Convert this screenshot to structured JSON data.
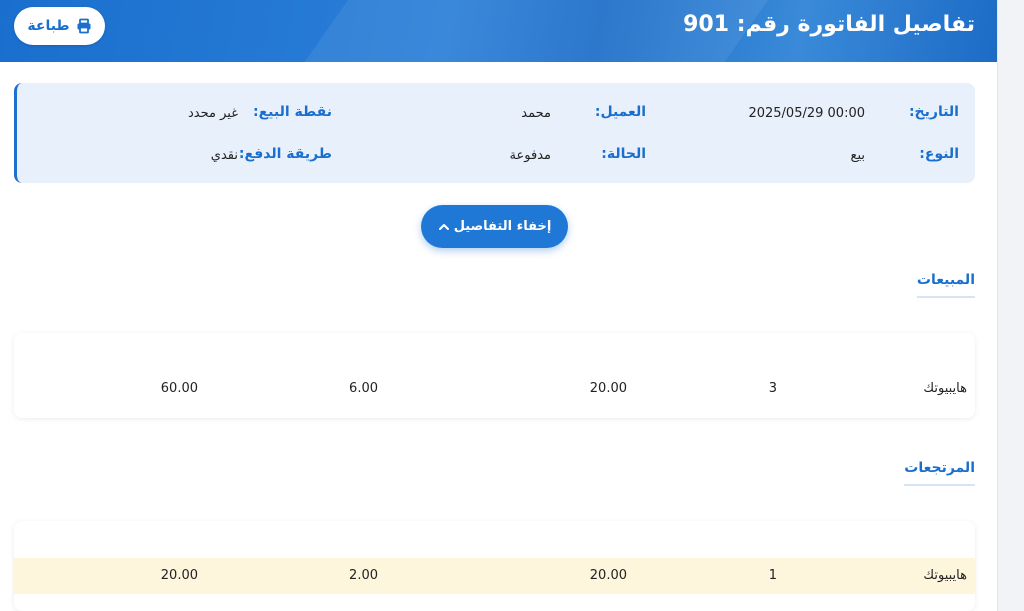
{
  "header": {
    "title": "تفاصيل الفاتورة رقم: 901",
    "print_label": "طباعة"
  },
  "info": {
    "date_label": "التاريخ:",
    "date_value": "2025/05/29 00:00",
    "customer_label": "العميل:",
    "customer_value": "محمد",
    "pos_label": "نقطة البيع:",
    "pos_value": "غير محدد",
    "type_label": "النوع:",
    "type_value": "بيع",
    "status_label": "الحالة:",
    "status_value": "مدفوعة",
    "payment_label": "طريقة الدفع:",
    "payment_value": "نقدي"
  },
  "toggle": {
    "label": "إخفاء التفاصيل"
  },
  "sales": {
    "title": "المبيعات",
    "rows": [
      {
        "product": "هايبيوتك",
        "quantity": "3",
        "price": "20.00",
        "discount": "6.00",
        "total": "60.00"
      }
    ]
  },
  "returns": {
    "title": "المرتجعات",
    "rows": [
      {
        "product": "هايبيوتك",
        "quantity": "1",
        "price": "20.00",
        "discount": "2.00",
        "total": "20.00"
      }
    ]
  },
  "colors": {
    "primary": "#1a6fce",
    "info_bg": "#e7f0fb",
    "highlight_row": "#fdf5dc"
  },
  "icons": {
    "print": "printer-icon",
    "toggle": "chevron-up-icon"
  }
}
